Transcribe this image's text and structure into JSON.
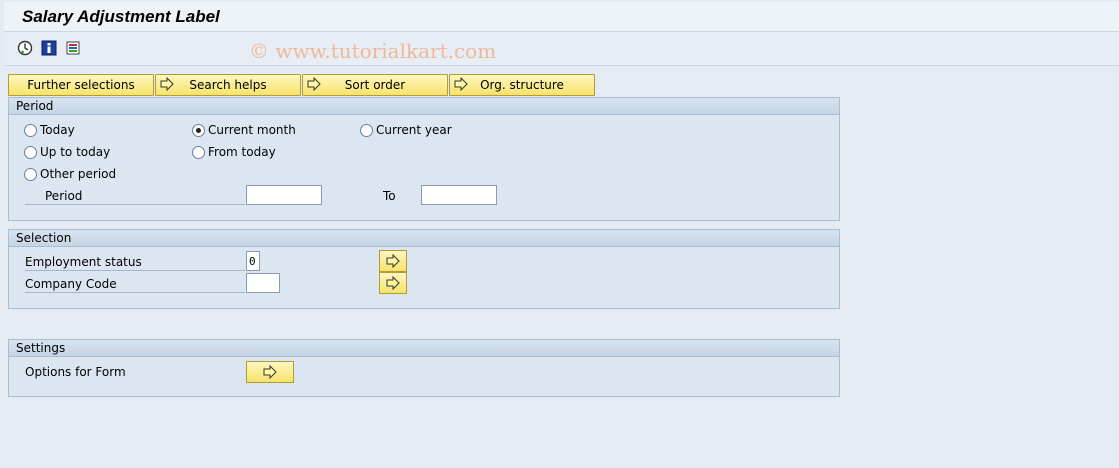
{
  "title": "Salary Adjustment Label",
  "watermark": "© www.tutorialkart.com",
  "toolbar": {
    "icons": [
      "execute-clock-icon",
      "info-icon",
      "variants-icon"
    ]
  },
  "buttons": [
    "Further selections",
    "Search helps",
    "Sort order",
    "Org. structure"
  ],
  "period": {
    "header": "Period",
    "options": [
      "Today",
      "Current month",
      "Current year",
      "Up to today",
      "From today",
      "Other period"
    ],
    "selected": "Current month",
    "period_label": "Period",
    "to_label": "To",
    "period_from": "",
    "period_to": ""
  },
  "selection": {
    "header": "Selection",
    "employment_status_label": "Employment status",
    "employment_status_value": "0",
    "company_code_label": "Company Code",
    "company_code_value": ""
  },
  "settings": {
    "header": "Settings",
    "options_label": "Options for Form"
  },
  "colors": {
    "button_yellow": "#f6e36a",
    "background": "#e4ebf3",
    "watermark": "#f0b89a"
  }
}
